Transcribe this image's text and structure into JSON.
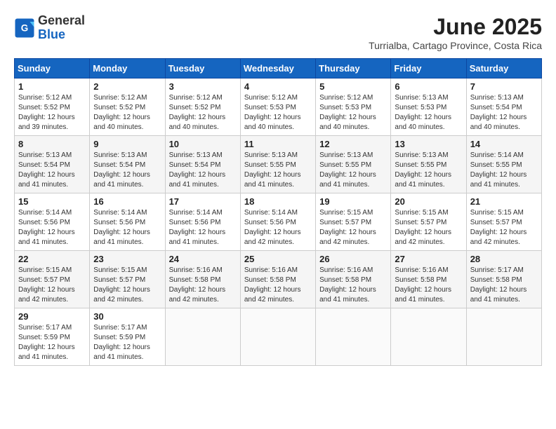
{
  "header": {
    "logo_general": "General",
    "logo_blue": "Blue",
    "month_year": "June 2025",
    "location": "Turrialba, Cartago Province, Costa Rica"
  },
  "weekdays": [
    "Sunday",
    "Monday",
    "Tuesday",
    "Wednesday",
    "Thursday",
    "Friday",
    "Saturday"
  ],
  "weeks": [
    [
      {
        "day": "1",
        "sunrise": "5:12 AM",
        "sunset": "5:52 PM",
        "daylight": "12 hours and 39 minutes."
      },
      {
        "day": "2",
        "sunrise": "5:12 AM",
        "sunset": "5:52 PM",
        "daylight": "12 hours and 40 minutes."
      },
      {
        "day": "3",
        "sunrise": "5:12 AM",
        "sunset": "5:52 PM",
        "daylight": "12 hours and 40 minutes."
      },
      {
        "day": "4",
        "sunrise": "5:12 AM",
        "sunset": "5:53 PM",
        "daylight": "12 hours and 40 minutes."
      },
      {
        "day": "5",
        "sunrise": "5:12 AM",
        "sunset": "5:53 PM",
        "daylight": "12 hours and 40 minutes."
      },
      {
        "day": "6",
        "sunrise": "5:13 AM",
        "sunset": "5:53 PM",
        "daylight": "12 hours and 40 minutes."
      },
      {
        "day": "7",
        "sunrise": "5:13 AM",
        "sunset": "5:54 PM",
        "daylight": "12 hours and 40 minutes."
      }
    ],
    [
      {
        "day": "8",
        "sunrise": "5:13 AM",
        "sunset": "5:54 PM",
        "daylight": "12 hours and 41 minutes."
      },
      {
        "day": "9",
        "sunrise": "5:13 AM",
        "sunset": "5:54 PM",
        "daylight": "12 hours and 41 minutes."
      },
      {
        "day": "10",
        "sunrise": "5:13 AM",
        "sunset": "5:54 PM",
        "daylight": "12 hours and 41 minutes."
      },
      {
        "day": "11",
        "sunrise": "5:13 AM",
        "sunset": "5:55 PM",
        "daylight": "12 hours and 41 minutes."
      },
      {
        "day": "12",
        "sunrise": "5:13 AM",
        "sunset": "5:55 PM",
        "daylight": "12 hours and 41 minutes."
      },
      {
        "day": "13",
        "sunrise": "5:13 AM",
        "sunset": "5:55 PM",
        "daylight": "12 hours and 41 minutes."
      },
      {
        "day": "14",
        "sunrise": "5:14 AM",
        "sunset": "5:55 PM",
        "daylight": "12 hours and 41 minutes."
      }
    ],
    [
      {
        "day": "15",
        "sunrise": "5:14 AM",
        "sunset": "5:56 PM",
        "daylight": "12 hours and 41 minutes."
      },
      {
        "day": "16",
        "sunrise": "5:14 AM",
        "sunset": "5:56 PM",
        "daylight": "12 hours and 41 minutes."
      },
      {
        "day": "17",
        "sunrise": "5:14 AM",
        "sunset": "5:56 PM",
        "daylight": "12 hours and 41 minutes."
      },
      {
        "day": "18",
        "sunrise": "5:14 AM",
        "sunset": "5:56 PM",
        "daylight": "12 hours and 42 minutes."
      },
      {
        "day": "19",
        "sunrise": "5:15 AM",
        "sunset": "5:57 PM",
        "daylight": "12 hours and 42 minutes."
      },
      {
        "day": "20",
        "sunrise": "5:15 AM",
        "sunset": "5:57 PM",
        "daylight": "12 hours and 42 minutes."
      },
      {
        "day": "21",
        "sunrise": "5:15 AM",
        "sunset": "5:57 PM",
        "daylight": "12 hours and 42 minutes."
      }
    ],
    [
      {
        "day": "22",
        "sunrise": "5:15 AM",
        "sunset": "5:57 PM",
        "daylight": "12 hours and 42 minutes."
      },
      {
        "day": "23",
        "sunrise": "5:15 AM",
        "sunset": "5:57 PM",
        "daylight": "12 hours and 42 minutes."
      },
      {
        "day": "24",
        "sunrise": "5:16 AM",
        "sunset": "5:58 PM",
        "daylight": "12 hours and 42 minutes."
      },
      {
        "day": "25",
        "sunrise": "5:16 AM",
        "sunset": "5:58 PM",
        "daylight": "12 hours and 42 minutes."
      },
      {
        "day": "26",
        "sunrise": "5:16 AM",
        "sunset": "5:58 PM",
        "daylight": "12 hours and 41 minutes."
      },
      {
        "day": "27",
        "sunrise": "5:16 AM",
        "sunset": "5:58 PM",
        "daylight": "12 hours and 41 minutes."
      },
      {
        "day": "28",
        "sunrise": "5:17 AM",
        "sunset": "5:58 PM",
        "daylight": "12 hours and 41 minutes."
      }
    ],
    [
      {
        "day": "29",
        "sunrise": "5:17 AM",
        "sunset": "5:59 PM",
        "daylight": "12 hours and 41 minutes."
      },
      {
        "day": "30",
        "sunrise": "5:17 AM",
        "sunset": "5:59 PM",
        "daylight": "12 hours and 41 minutes."
      },
      null,
      null,
      null,
      null,
      null
    ]
  ]
}
